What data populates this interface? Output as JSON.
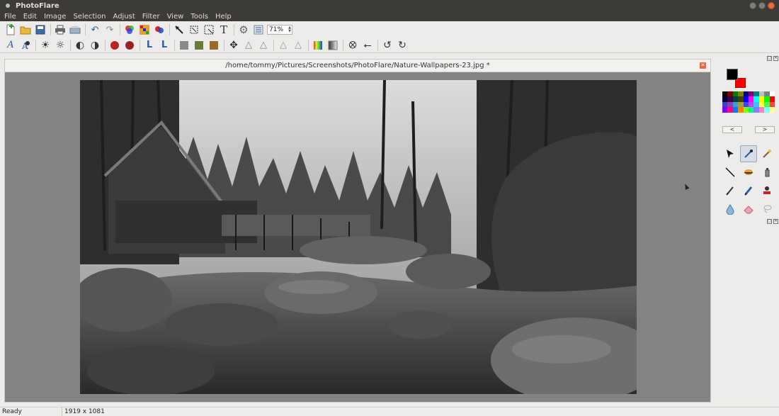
{
  "window": {
    "title": "PhotoFlare"
  },
  "menu": [
    "File",
    "Edit",
    "Image",
    "Selection",
    "Adjust",
    "Filter",
    "View",
    "Tools",
    "Help"
  ],
  "toolbar": {
    "zoom_value": "71%"
  },
  "document": {
    "title": "/home/tommy/Pictures/Screenshots/PhotoFlare/Nature-Wallpapers-23.jpg *"
  },
  "colors": {
    "foreground": "#000000",
    "background": "#ff0000"
  },
  "palette": [
    "#000000",
    "#800000",
    "#008000",
    "#808000",
    "#000080",
    "#800080",
    "#008080",
    "#c0c0c0",
    "#808080",
    "#ffffff",
    "#000040",
    "#400040",
    "#004040",
    "#404000",
    "#0000ff",
    "#ff00ff",
    "#00ffff",
    "#ffff00",
    "#00ff00",
    "#ff0000",
    "#4040c0",
    "#8040c0",
    "#40a0c0",
    "#a0a040",
    "#4040ff",
    "#c040ff",
    "#40c0ff",
    "#ffff40",
    "#40ff40",
    "#ff4040",
    "#8000ff",
    "#ff0080",
    "#0080ff",
    "#ff8000",
    "#80ff00",
    "#00ff80",
    "#8080ff",
    "#ff80c0",
    "#80ffff",
    "#ffff80"
  ],
  "palette_nav": {
    "prev": "<",
    "next": ">"
  },
  "status": {
    "text": "Ready",
    "dimensions": "1919 x 1081"
  }
}
